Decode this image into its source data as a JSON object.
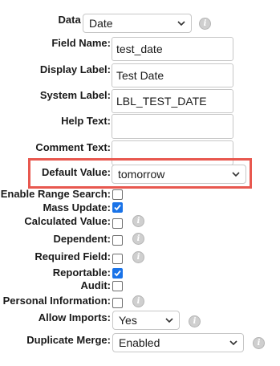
{
  "fields": {
    "data_type": {
      "label": "Data Type:",
      "value": "Date"
    },
    "field_name": {
      "label": "Field Name:",
      "value": "test_date"
    },
    "display_label": {
      "label": "Display Label:",
      "value": "Test Date"
    },
    "system_label": {
      "label": "System Label:",
      "value": "LBL_TEST_DATE"
    },
    "help_text": {
      "label": "Help Text:",
      "value": ""
    },
    "comment_text": {
      "label": "Comment Text:",
      "value": ""
    },
    "default_value": {
      "label": "Default Value:",
      "value": "tomorrow"
    },
    "enable_range_search": {
      "label": "Enable Range Search:",
      "checked": false
    },
    "mass_update": {
      "label": "Mass Update:",
      "checked": true
    },
    "calculated_value": {
      "label": "Calculated Value:",
      "checked": false
    },
    "dependent": {
      "label": "Dependent:",
      "checked": false
    },
    "required_field": {
      "label": "Required Field:",
      "checked": false
    },
    "reportable": {
      "label": "Reportable:",
      "checked": true
    },
    "audit": {
      "label": "Audit:",
      "checked": false
    },
    "personal_information": {
      "label": "Personal Information:",
      "checked": false
    },
    "allow_imports": {
      "label": "Allow Imports:",
      "value": "Yes"
    },
    "duplicate_merge": {
      "label": "Duplicate Merge:",
      "value": "Enabled"
    }
  },
  "icons": {
    "info": "info-icon",
    "dropdown": "chevron-down-icon",
    "check": "checkmark-icon"
  },
  "info_glyph": "i",
  "colors": {
    "highlight": "#e8584f",
    "checkbox_checked": "#1a73e8"
  }
}
